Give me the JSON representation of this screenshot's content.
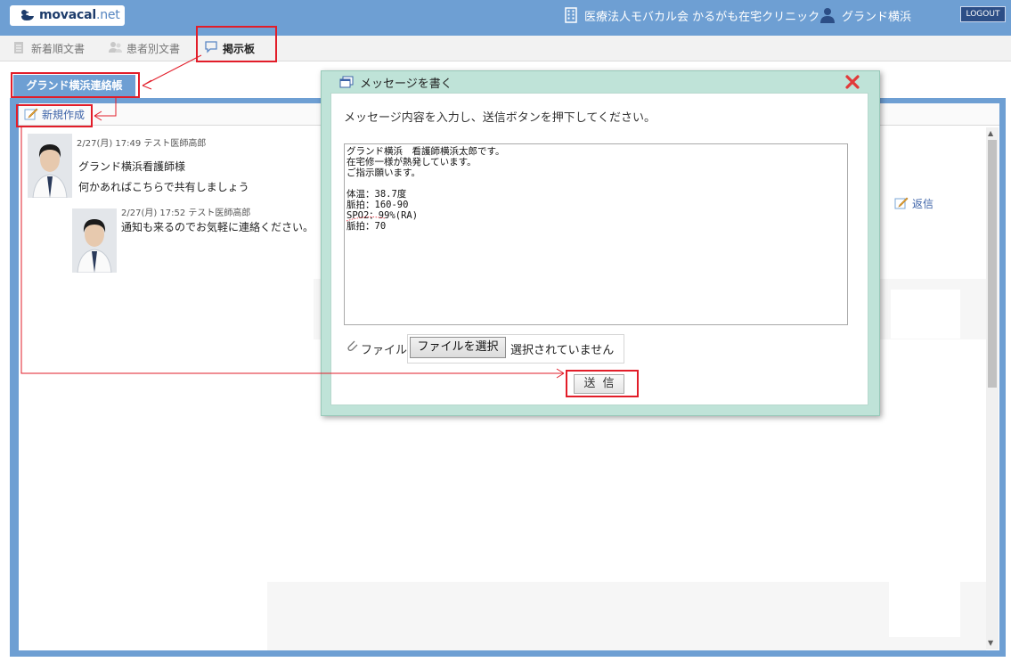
{
  "header": {
    "logo_main": "movacal",
    "logo_dot": ".",
    "logo_tld": "net",
    "clinic_name": "医療法人モバカル会 かるがも在宅クリニック",
    "user_name": "グランド横浜",
    "logout_label": "LOGOUT",
    "bar_color": "#6e9fd3"
  },
  "tabs": [
    {
      "label": "新着順文書",
      "icon": "document-icon",
      "active": false
    },
    {
      "label": "患者別文書",
      "icon": "people-icon",
      "active": false
    },
    {
      "label": "掲示板",
      "icon": "speech-bubble-icon",
      "active": true
    }
  ],
  "board": {
    "title": "グランド横浜連絡帳",
    "new_label": "新規作成",
    "reply_label": "返信",
    "posts": [
      {
        "meta": "2/27(月) 17:49 テスト医師高郎",
        "lines": [
          "グランド横浜看護師様",
          "何かあればこちらで共有しましょう"
        ]
      },
      {
        "meta": "2/27(月) 17:52 テスト医師高郎",
        "lines": [
          "通知も来るのでお気軽に連絡ください。"
        ]
      }
    ]
  },
  "modal": {
    "title": "メッセージを書く",
    "instruction": "メッセージ内容を入力し、送信ボタンを押下してください。",
    "message": "グランド横浜　看護師横浜太郎です。\n在宅修一様が熱発しています。\nご指示願います。\n\n体温：38.7度\n脈拍：160-90\nSPO2：99%(RA)\n脈拍：70",
    "file_label": "ファイル",
    "file_button": "ファイルを選択",
    "file_status": "選択されていません",
    "send_label": "送信"
  },
  "colors": {
    "accent": "#6e9fd3",
    "modal_frame": "#bfe3d8",
    "annotation_red": "#e21d29",
    "link_blue": "#3d63a8"
  }
}
